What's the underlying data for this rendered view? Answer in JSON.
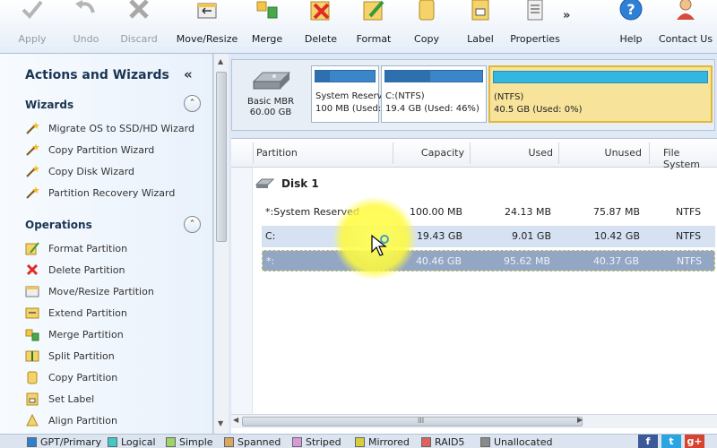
{
  "toolbar": {
    "buttons": [
      {
        "id": "apply",
        "label": "Apply",
        "icon": "checkmark-icon",
        "disabled": true
      },
      {
        "id": "undo",
        "label": "Undo",
        "icon": "undo-arrow-icon",
        "disabled": true
      },
      {
        "id": "discard",
        "label": "Discard",
        "icon": "x-icon",
        "disabled": true
      },
      {
        "id": "move-resize",
        "label": "Move/Resize",
        "icon": "move-resize-icon"
      },
      {
        "id": "merge",
        "label": "Merge",
        "icon": "merge-icon"
      },
      {
        "id": "delete",
        "label": "Delete",
        "icon": "delete-icon"
      },
      {
        "id": "format",
        "label": "Format",
        "icon": "format-icon"
      },
      {
        "id": "copy",
        "label": "Copy",
        "icon": "copy-icon"
      },
      {
        "id": "label",
        "label": "Label",
        "icon": "label-icon"
      },
      {
        "id": "properties",
        "label": "Properties",
        "icon": "properties-icon"
      },
      {
        "id": "help",
        "label": "Help",
        "icon": "help-icon"
      },
      {
        "id": "contact",
        "label": "Contact Us",
        "icon": "contact-icon"
      }
    ],
    "more": "»"
  },
  "left_panel": {
    "title": "Actions and Wizards",
    "collapse_glyph": "«",
    "sections": [
      {
        "title": "Wizards",
        "toggle": "⌃",
        "items": [
          "Migrate OS to SSD/HD Wizard",
          "Copy Partition Wizard",
          "Copy Disk Wizard",
          "Partition Recovery Wizard"
        ]
      },
      {
        "title": "Operations",
        "toggle": "⌃",
        "items": [
          "Format Partition",
          "Delete Partition",
          "Move/Resize Partition",
          "Extend Partition",
          "Merge Partition",
          "Split Partition",
          "Copy Partition",
          "Set Label",
          "Align Partition"
        ]
      }
    ]
  },
  "disk_map": {
    "disk": {
      "line1": "Basic MBR",
      "line2": "60.00 GB"
    },
    "partitions": [
      {
        "name": "System Reserv",
        "size": "100 MB (Used:",
        "used_fraction": 0.24
      },
      {
        "name": "C:(NTFS)",
        "size": "19.4 GB (Used: 46%)",
        "used_fraction": 0.46
      },
      {
        "name": "(NTFS)",
        "size": "40.5 GB (Used: 0%)",
        "used_fraction": 0.0,
        "selected": true
      }
    ]
  },
  "table": {
    "columns": [
      "Partition",
      "Capacity",
      "Used",
      "Unused",
      "File System"
    ],
    "disk_label": "Disk 1",
    "rows": [
      {
        "partition": "*:System Reserved",
        "capacity": "100.00 MB",
        "used": "24.13 MB",
        "unused": "75.87 MB",
        "fs": "NTFS"
      },
      {
        "partition": "C:",
        "capacity": "19.43 GB",
        "used": "9.01 GB",
        "unused": "10.42 GB",
        "fs": "NTFS"
      },
      {
        "partition": "*:",
        "capacity": "40.46 GB",
        "used": "95.62 MB",
        "unused": "40.37 GB",
        "fs": "NTFS"
      }
    ],
    "scroll_grip": "III"
  },
  "legend": [
    {
      "label": "GPT/Primary",
      "color": "#2f7fd0"
    },
    {
      "label": "Logical",
      "color": "#43c8c8"
    },
    {
      "label": "Simple",
      "color": "#9ed36a"
    },
    {
      "label": "Spanned",
      "color": "#d8a860"
    },
    {
      "label": "Striped",
      "color": "#d79ad6"
    },
    {
      "label": "Mirrored",
      "color": "#d6cf3a"
    },
    {
      "label": "RAID5",
      "color": "#e06060"
    },
    {
      "label": "Unallocated",
      "color": "#8a8a8a"
    }
  ],
  "social": [
    "f",
    "t",
    "g+"
  ]
}
